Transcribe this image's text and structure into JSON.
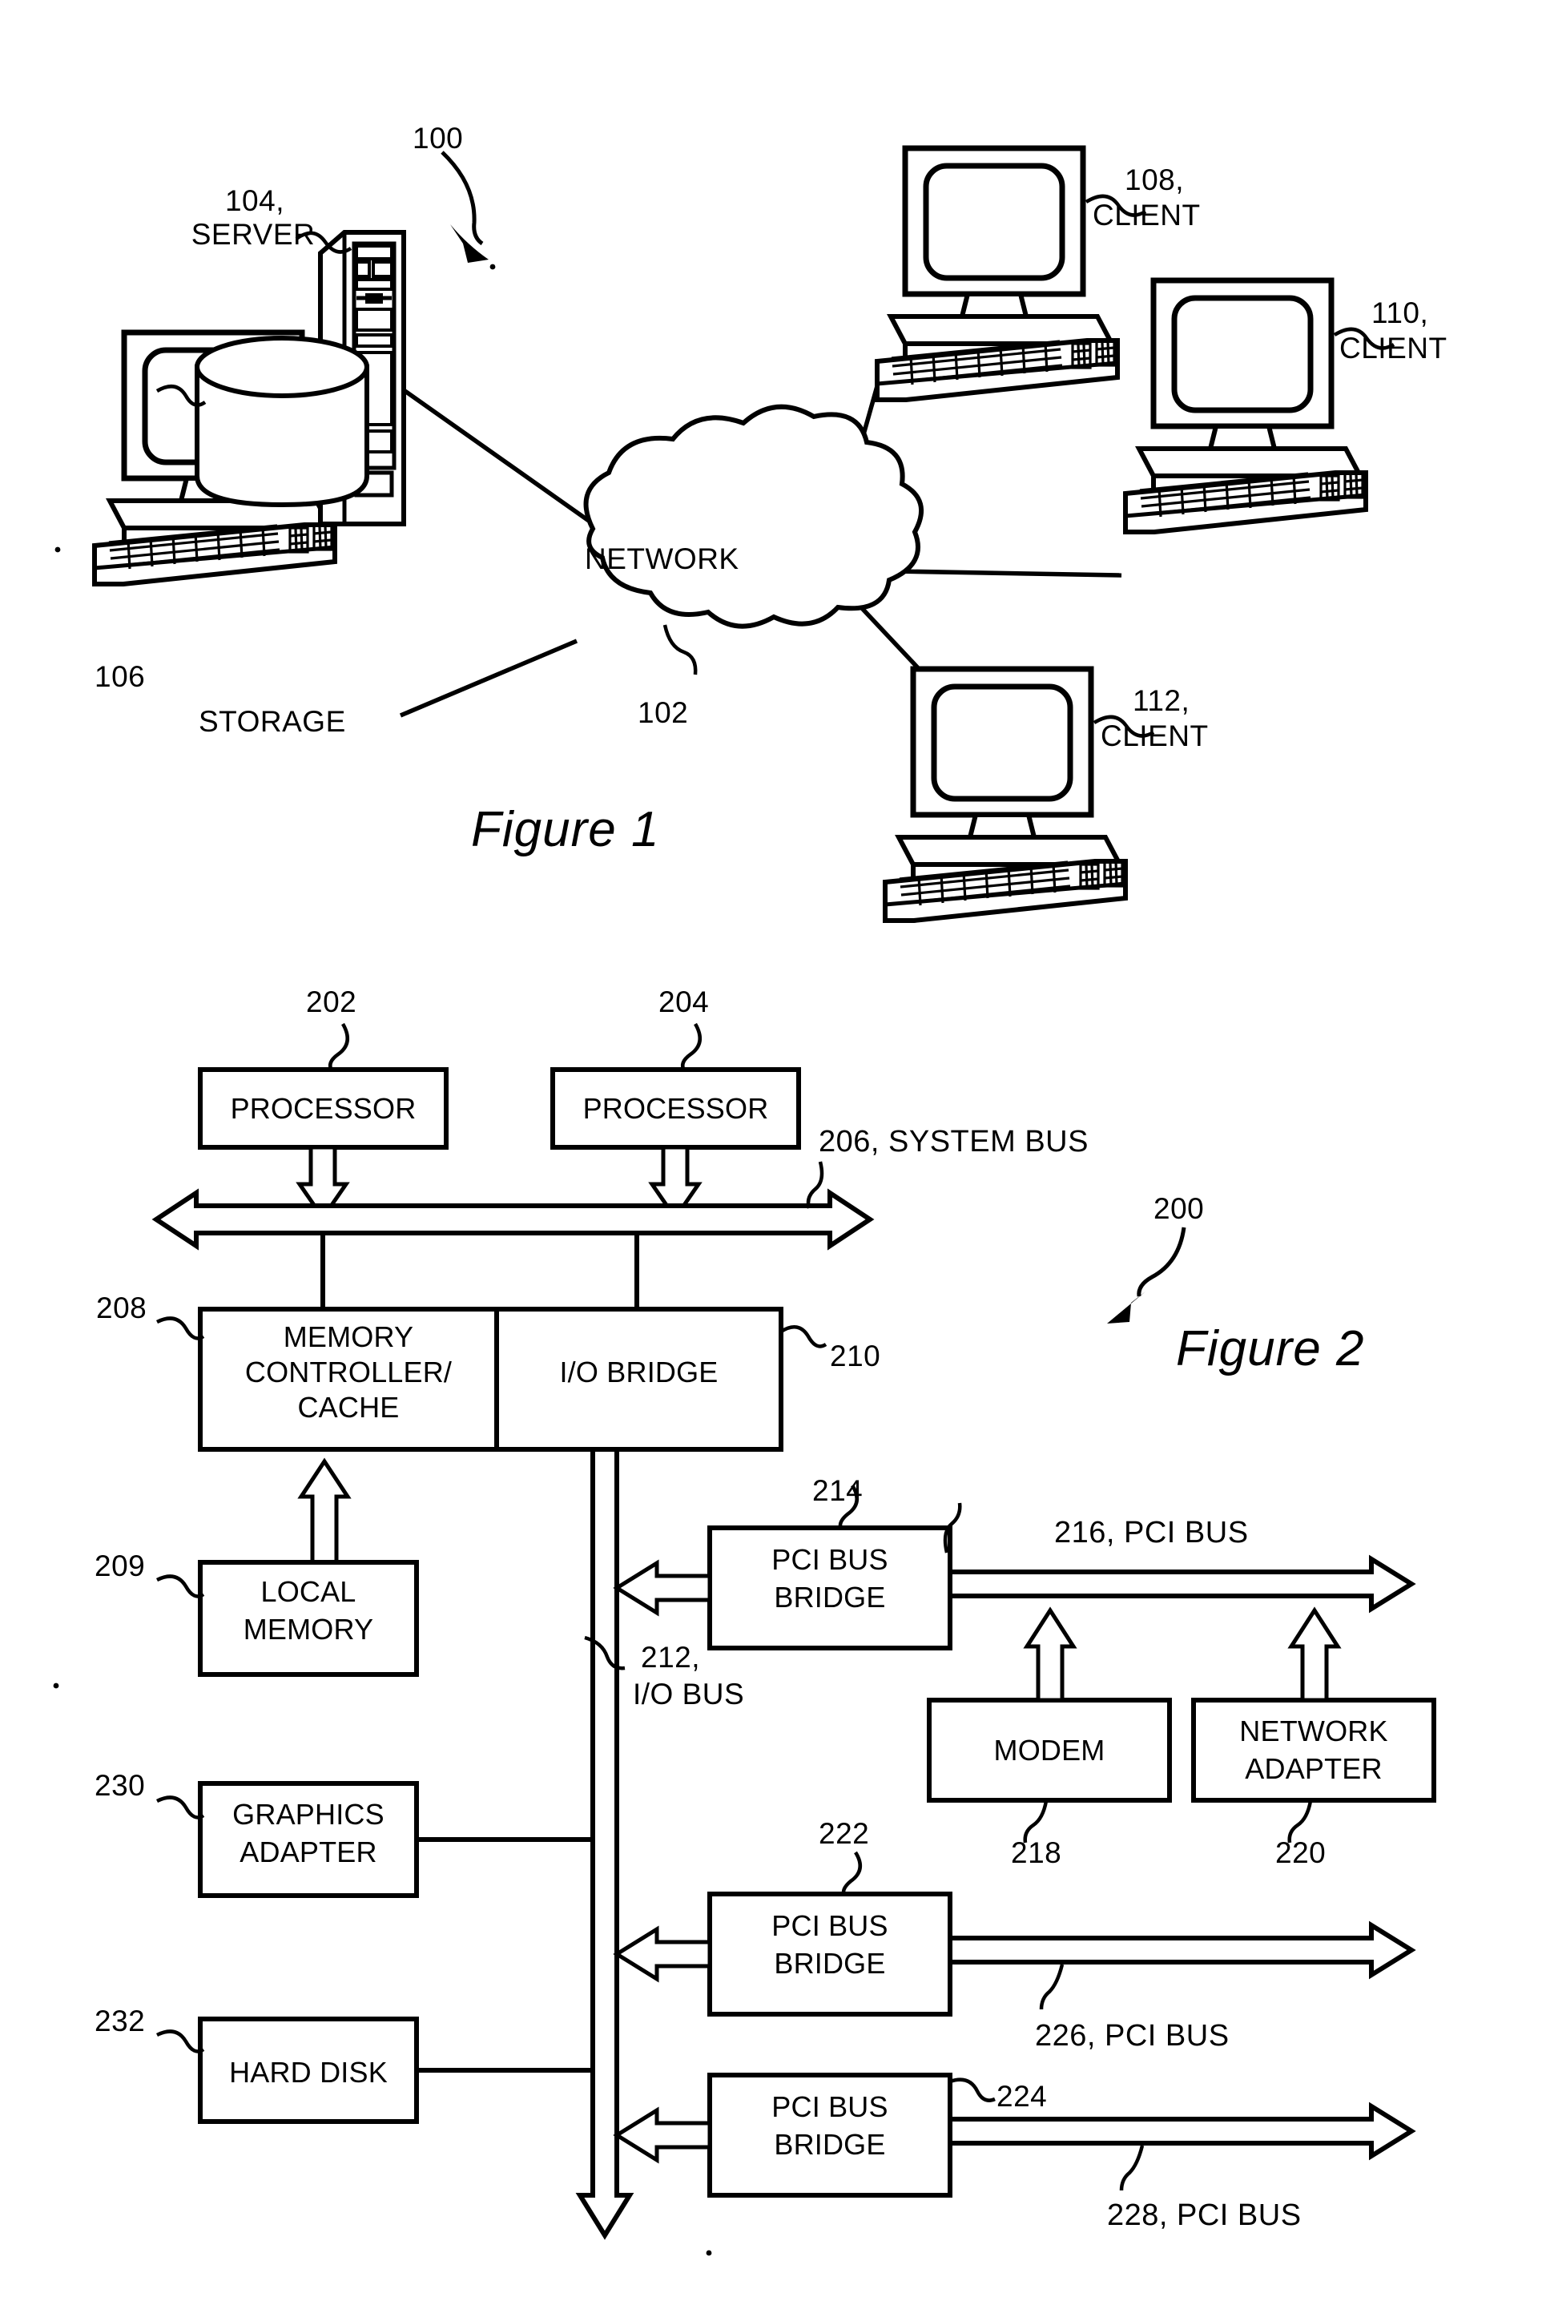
{
  "figure1": {
    "caption": "Figure 1",
    "system_ref": "100",
    "network": {
      "label": "NETWORK",
      "ref": "102"
    },
    "server": {
      "ref_line1": "104,",
      "ref_line2": "SERVER"
    },
    "storage": {
      "ref": "106",
      "label": "STORAGE"
    },
    "clients": [
      {
        "ref_line1": "108,",
        "ref_line2": "CLIENT"
      },
      {
        "ref_line1": "110,",
        "ref_line2": "CLIENT"
      },
      {
        "ref_line1": "112,",
        "ref_line2": "CLIENT"
      }
    ]
  },
  "figure2": {
    "caption": "Figure 2",
    "system_ref": "200",
    "blocks": {
      "processor_left": {
        "ref": "202",
        "label": "PROCESSOR"
      },
      "processor_right": {
        "ref": "204",
        "label": "PROCESSOR"
      },
      "memory_controller": {
        "ref": "208",
        "label_line1": "MEMORY",
        "label_line2": "CONTROLLER/",
        "label_line3": "CACHE"
      },
      "io_bridge": {
        "ref": "210",
        "label": "I/O BRIDGE"
      },
      "local_memory": {
        "ref": "209",
        "label_line1": "LOCAL",
        "label_line2": "MEMORY"
      },
      "graphics_adapter": {
        "ref": "230",
        "label_line1": "GRAPHICS",
        "label_line2": "ADAPTER"
      },
      "hard_disk": {
        "ref": "232",
        "label": "HARD DISK"
      },
      "pci_bridge_1": {
        "ref": "214",
        "label_line1": "PCI BUS",
        "label_line2": "BRIDGE"
      },
      "pci_bridge_2": {
        "ref": "222",
        "label_line1": "PCI BUS",
        "label_line2": "BRIDGE"
      },
      "pci_bridge_3": {
        "ref": "224",
        "label_line1": "PCI BUS",
        "label_line2": "BRIDGE"
      },
      "modem": {
        "ref": "218",
        "label": "MODEM"
      },
      "network_adapter": {
        "ref": "220",
        "label_line1": "NETWORK",
        "label_line2": "ADAPTER"
      }
    },
    "buses": {
      "system_bus": "206, SYSTEM BUS",
      "io_bus_line1": "212,",
      "io_bus_line2": "I/O BUS",
      "pci_bus_216": "216, PCI BUS",
      "pci_bus_226": "226, PCI BUS",
      "pci_bus_228": "228, PCI BUS"
    }
  }
}
